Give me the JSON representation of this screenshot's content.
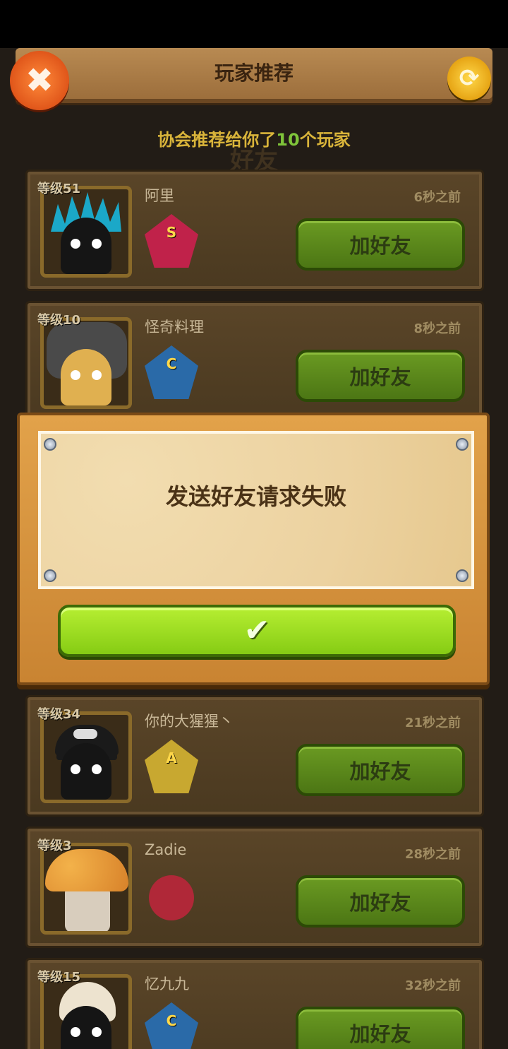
{
  "header": {
    "title": "玩家推荐",
    "close_icon": "✖",
    "refresh_icon": "⟳"
  },
  "subtitle": {
    "prefix": "协会推荐给你了",
    "count": "10",
    "suffix": "个玩家"
  },
  "ghost_tab": "好友",
  "players": [
    {
      "level": "等级51",
      "name": "阿里",
      "time": "6秒之前",
      "rank": "S",
      "button": "加好友"
    },
    {
      "level": "等级10",
      "name": "怪奇料理",
      "time": "8秒之前",
      "rank": "C",
      "button": "加好友"
    },
    {
      "level": "等级34",
      "name": "你的大猩猩丶",
      "time": "21秒之前",
      "rank": "A",
      "button": "加好友"
    },
    {
      "level": "等级3",
      "name": "Zadie",
      "time": "28秒之前",
      "rank": "",
      "button": "加好友"
    },
    {
      "level": "等级15",
      "name": "忆九九",
      "time": "32秒之前",
      "rank": "C",
      "button": "加好友"
    }
  ],
  "dialog": {
    "message": "发送好友请求失败",
    "confirm_icon": "✔"
  }
}
